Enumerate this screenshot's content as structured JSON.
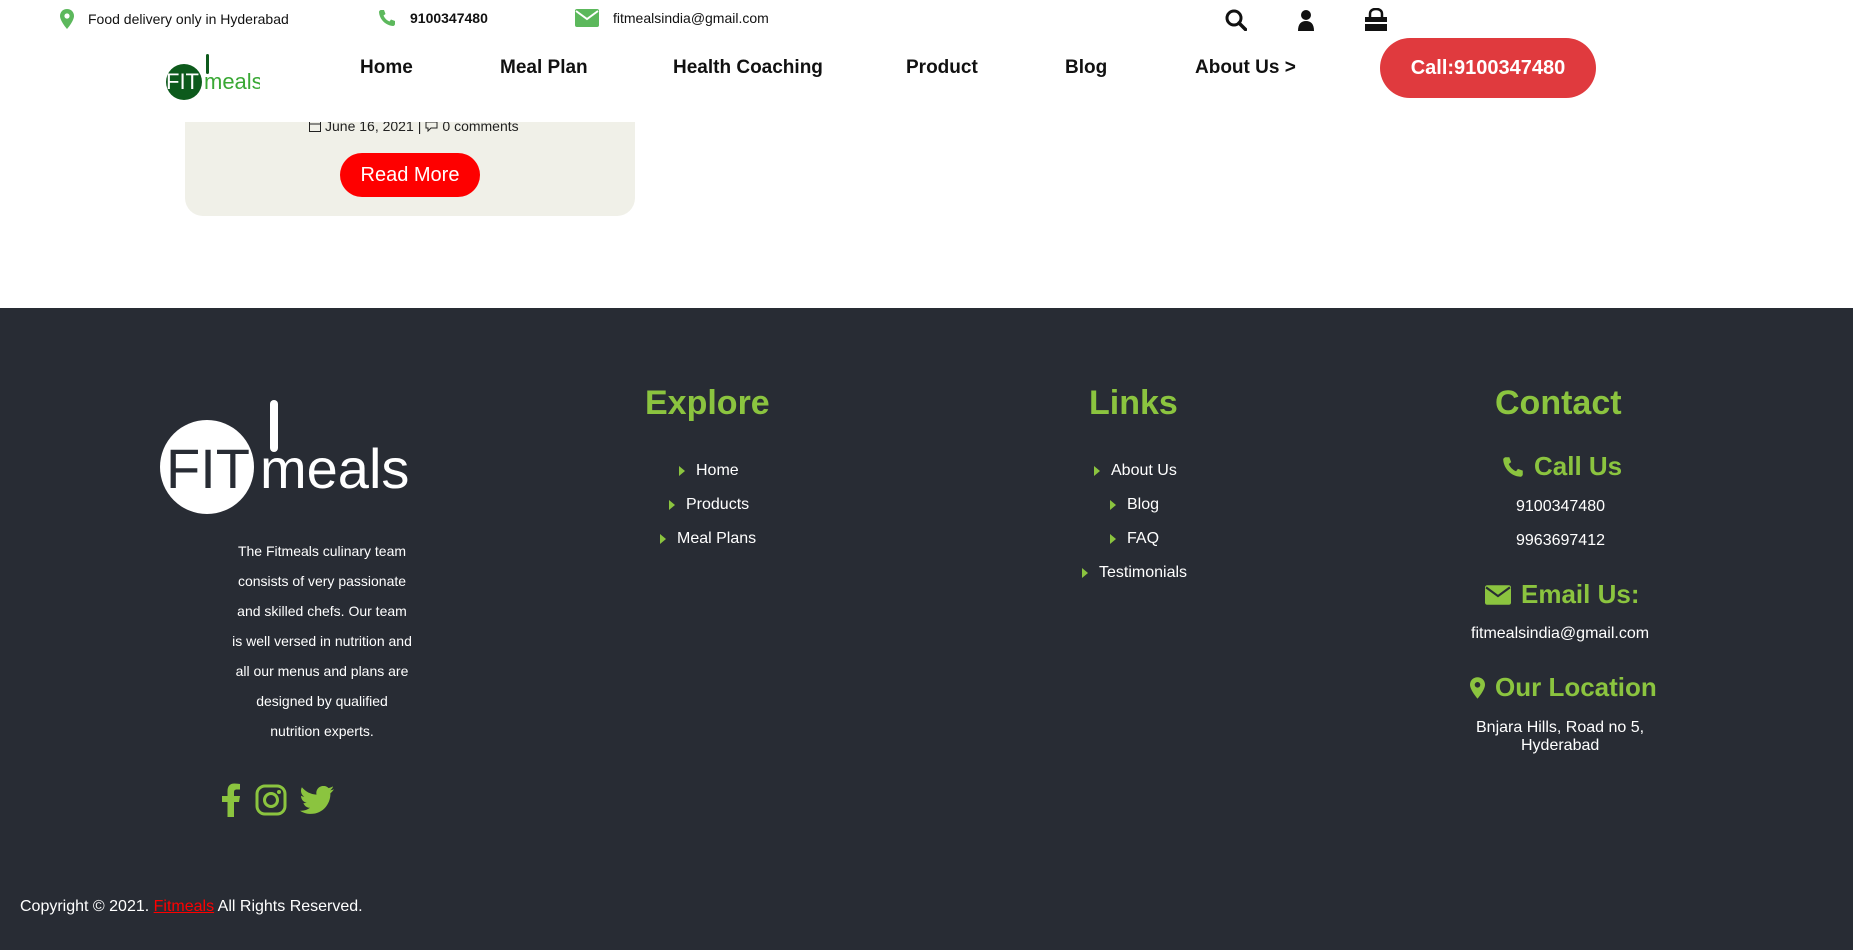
{
  "topbar": {
    "delivery_text": "Food delivery only in Hyderabad",
    "phone": "9100347480",
    "email": "fitmealsindia@gmail.com",
    "icons": [
      "map-marker-icon",
      "phone-icon",
      "envelope-icon",
      "search-icon",
      "user-icon",
      "shopping-bag-icon"
    ]
  },
  "logo": {
    "fit": "FIT",
    "meals": "meals"
  },
  "nav": {
    "items": [
      {
        "label": "Home"
      },
      {
        "label": "Meal Plan"
      },
      {
        "label": "Health Coaching"
      },
      {
        "label": "Product"
      },
      {
        "label": "Blog"
      },
      {
        "label": "About Us >"
      }
    ],
    "call_button": "Call:9100347480"
  },
  "blog_card": {
    "date": "June 16, 2021",
    "comments": "0 comments",
    "read_more": "Read More"
  },
  "footer": {
    "about_text": "The Fitmeals culinary team consists of very passionate and skilled chefs. Our team is well versed in nutrition and all our menus and plans are designed by qualified nutrition experts.",
    "social": [
      "facebook-icon",
      "instagram-icon",
      "twitter-icon"
    ],
    "explore": {
      "title": "Explore",
      "items": [
        {
          "label": "Home"
        },
        {
          "label": "Products"
        },
        {
          "label": "Meal Plans"
        }
      ]
    },
    "links": {
      "title": "Links",
      "items": [
        {
          "label": "About Us"
        },
        {
          "label": "Blog"
        },
        {
          "label": "FAQ"
        },
        {
          "label": "Testimonials"
        }
      ]
    },
    "contact": {
      "title": "Contact",
      "call_title": "Call Us",
      "phone1": "9100347480",
      "phone2": "9963697412",
      "email_title": "Email Us:",
      "email": "fitmealsindia@gmail.com",
      "location_title": "Our Location",
      "address_line1": "Bnjara Hills, Road no 5,",
      "address_line2": "Hyderabad"
    },
    "copyright_prefix": "Copyright © 2021.",
    "copyright_brand": "Fitmeals",
    "copyright_suffix": "All Rights Reserved."
  },
  "colors": {
    "brand_green": "#8bc43f",
    "footer_bg": "#282c34",
    "call_button": "#e03a3e",
    "read_more": "#fe0000",
    "logo_dark_green": "#0d5a1c"
  }
}
